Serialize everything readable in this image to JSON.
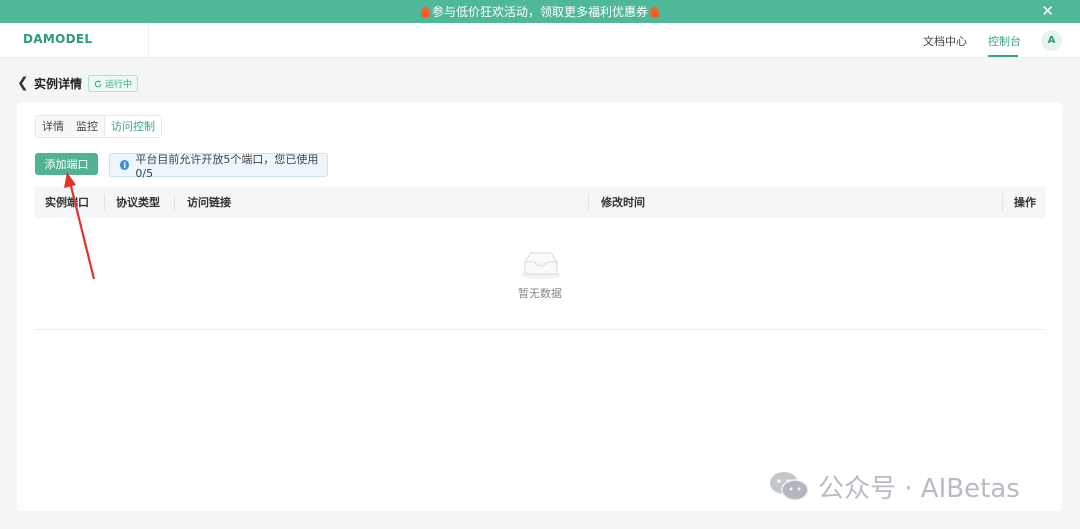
{
  "banner": {
    "text": "参与低价狂欢活动，领取更多福利优惠券",
    "close_label": "✕"
  },
  "header": {
    "logo": "DAMODEL",
    "nav_docs": "文档中心",
    "nav_console": "控制台",
    "avatar_letter": "A"
  },
  "page": {
    "back_label": "❮",
    "title": "实例详情",
    "status": "运行中"
  },
  "tabs": [
    {
      "label": "详情"
    },
    {
      "label": "监控"
    },
    {
      "label": "访问控制"
    }
  ],
  "active_tab": "访问控制",
  "toolbar": {
    "add_button": "添加端口",
    "info_text": "平台目前允许开放5个端口，您已使用 0/5"
  },
  "table": {
    "columns": [
      "实例端口",
      "协议类型",
      "访问链接",
      "修改时间",
      "操作"
    ],
    "rows": [],
    "empty_text": "暂无数据"
  },
  "watermark": {
    "text": "公众号 · AIBetas"
  },
  "colors": {
    "brand": "#3aa584",
    "banner": "#4fb898",
    "annotation": "#e5322d"
  }
}
